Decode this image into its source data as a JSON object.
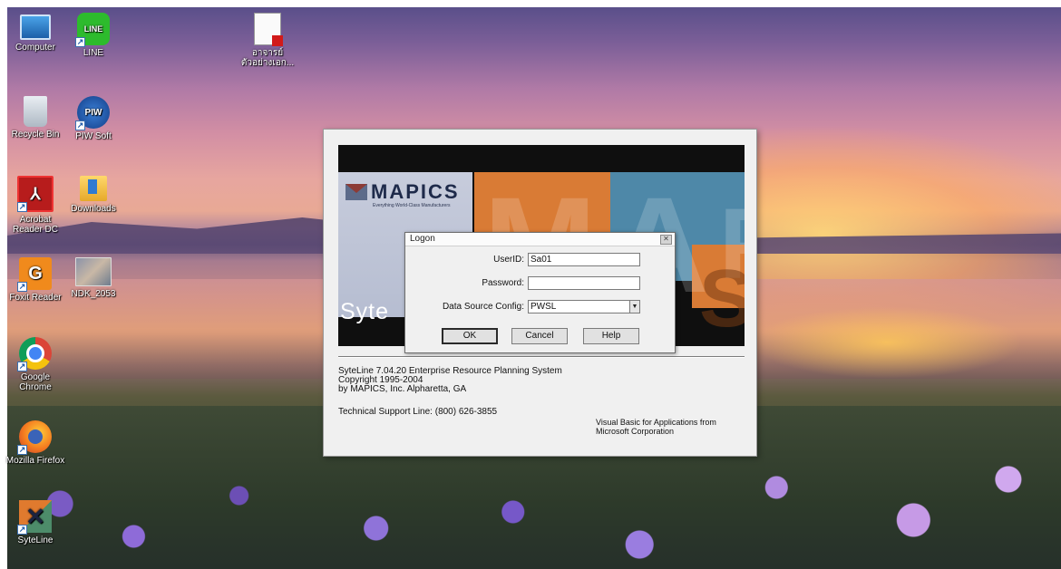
{
  "desktop_icons": [
    {
      "id": "computer",
      "label": "Computer"
    },
    {
      "id": "line",
      "label": "LINE",
      "glyph": "LINE"
    },
    {
      "id": "pdf-file",
      "label": "อาจารย์ ตัวอย่างเอก..."
    },
    {
      "id": "recycle-bin",
      "label": "Recycle Bin"
    },
    {
      "id": "piw-soft",
      "label": "PIW Soft",
      "glyph": "PIW"
    },
    {
      "id": "acrobat",
      "label": "Acrobat Reader DC"
    },
    {
      "id": "downloads",
      "label": "Downloads"
    },
    {
      "id": "foxit",
      "label": "Foxit Reader",
      "glyph": "G"
    },
    {
      "id": "ndk",
      "label": "NDK_2053"
    },
    {
      "id": "chrome",
      "label": "Google Chrome"
    },
    {
      "id": "firefox",
      "label": "Mozilla Firefox"
    },
    {
      "id": "syteline",
      "label": "SyteLine"
    }
  ],
  "splash": {
    "brand": "MAPICS",
    "brand_tagline": "Everything World-Class Manufacturers",
    "banner_letters": [
      "M",
      "A",
      "P",
      "S"
    ],
    "product_word": "Syte",
    "info_lines": [
      "SyteLine 7.04.20 Enterprise Resource Planning System",
      "Copyright 1995-2004",
      "by MAPICS, Inc. Alpharetta, GA"
    ],
    "support": "Technical Support Line: (800) 626-3855",
    "vba_lines": [
      "Visual Basic for Applications from",
      "Microsoft Corporation"
    ]
  },
  "logon": {
    "title": "Logon",
    "close_glyph": "✕",
    "userid_label": "UserID:",
    "userid_value": "Sa01",
    "password_label": "Password:",
    "password_value": "",
    "datasource_label": "Data Source Config:",
    "datasource_value": "PWSL",
    "ok_label": "OK",
    "cancel_label": "Cancel",
    "help_label": "Help"
  }
}
